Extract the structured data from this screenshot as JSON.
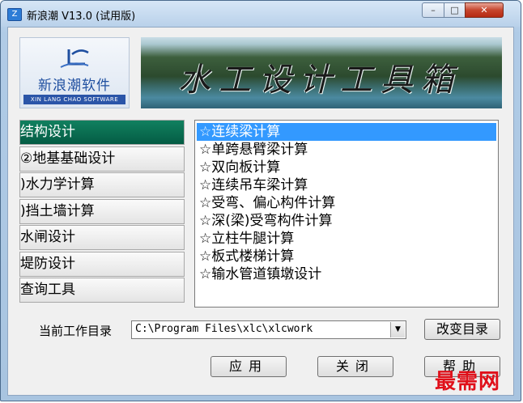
{
  "window": {
    "title": "新浪潮 V13.0 (试用版)",
    "controls": {
      "minimize": "–",
      "maximize": "□",
      "close": "✕"
    }
  },
  "logo": {
    "name": "新浪潮软件",
    "subtitle": "XIN LANG CHAO SOFTWARE"
  },
  "banner": {
    "title": "水工设计工具箱"
  },
  "nav": {
    "items": [
      {
        "label": "结构设计",
        "active": true
      },
      {
        "label": "②地基基础设计",
        "active": false
      },
      {
        "label": ")水力学计算",
        "active": false
      },
      {
        "label": ")挡土墙计算",
        "active": false
      },
      {
        "label": "水闸设计",
        "active": false
      },
      {
        "label": "堤防设计",
        "active": false
      },
      {
        "label": "查询工具",
        "active": false
      }
    ]
  },
  "list": {
    "items": [
      {
        "label": "☆连续梁计算",
        "selected": true
      },
      {
        "label": "☆单跨悬臂梁计算",
        "selected": false
      },
      {
        "label": "☆双向板计算",
        "selected": false
      },
      {
        "label": "☆连续吊车梁计算",
        "selected": false
      },
      {
        "label": "☆受弯、偏心构件计算",
        "selected": false
      },
      {
        "label": "☆深(梁)受弯构件计算",
        "selected": false
      },
      {
        "label": "☆立柱牛腿计算",
        "selected": false
      },
      {
        "label": "☆板式楼梯计算",
        "selected": false
      },
      {
        "label": "☆输水管道镇墩设计",
        "selected": false
      }
    ]
  },
  "workdir": {
    "label": "当前工作目录",
    "value": "C:\\Program Files\\xlc\\xlcwork"
  },
  "buttons": {
    "change_dir": "改变目录",
    "apply": "应用",
    "close": "关闭",
    "help": "帮助"
  },
  "watermark": "最需网",
  "colors": {
    "nav_active": "#0a6b50",
    "selection": "#3399ff",
    "watermark": "#e0101a"
  },
  "icons": [
    "app-icon",
    "logo-mark-icon",
    "dropdown-arrow-icon"
  ]
}
